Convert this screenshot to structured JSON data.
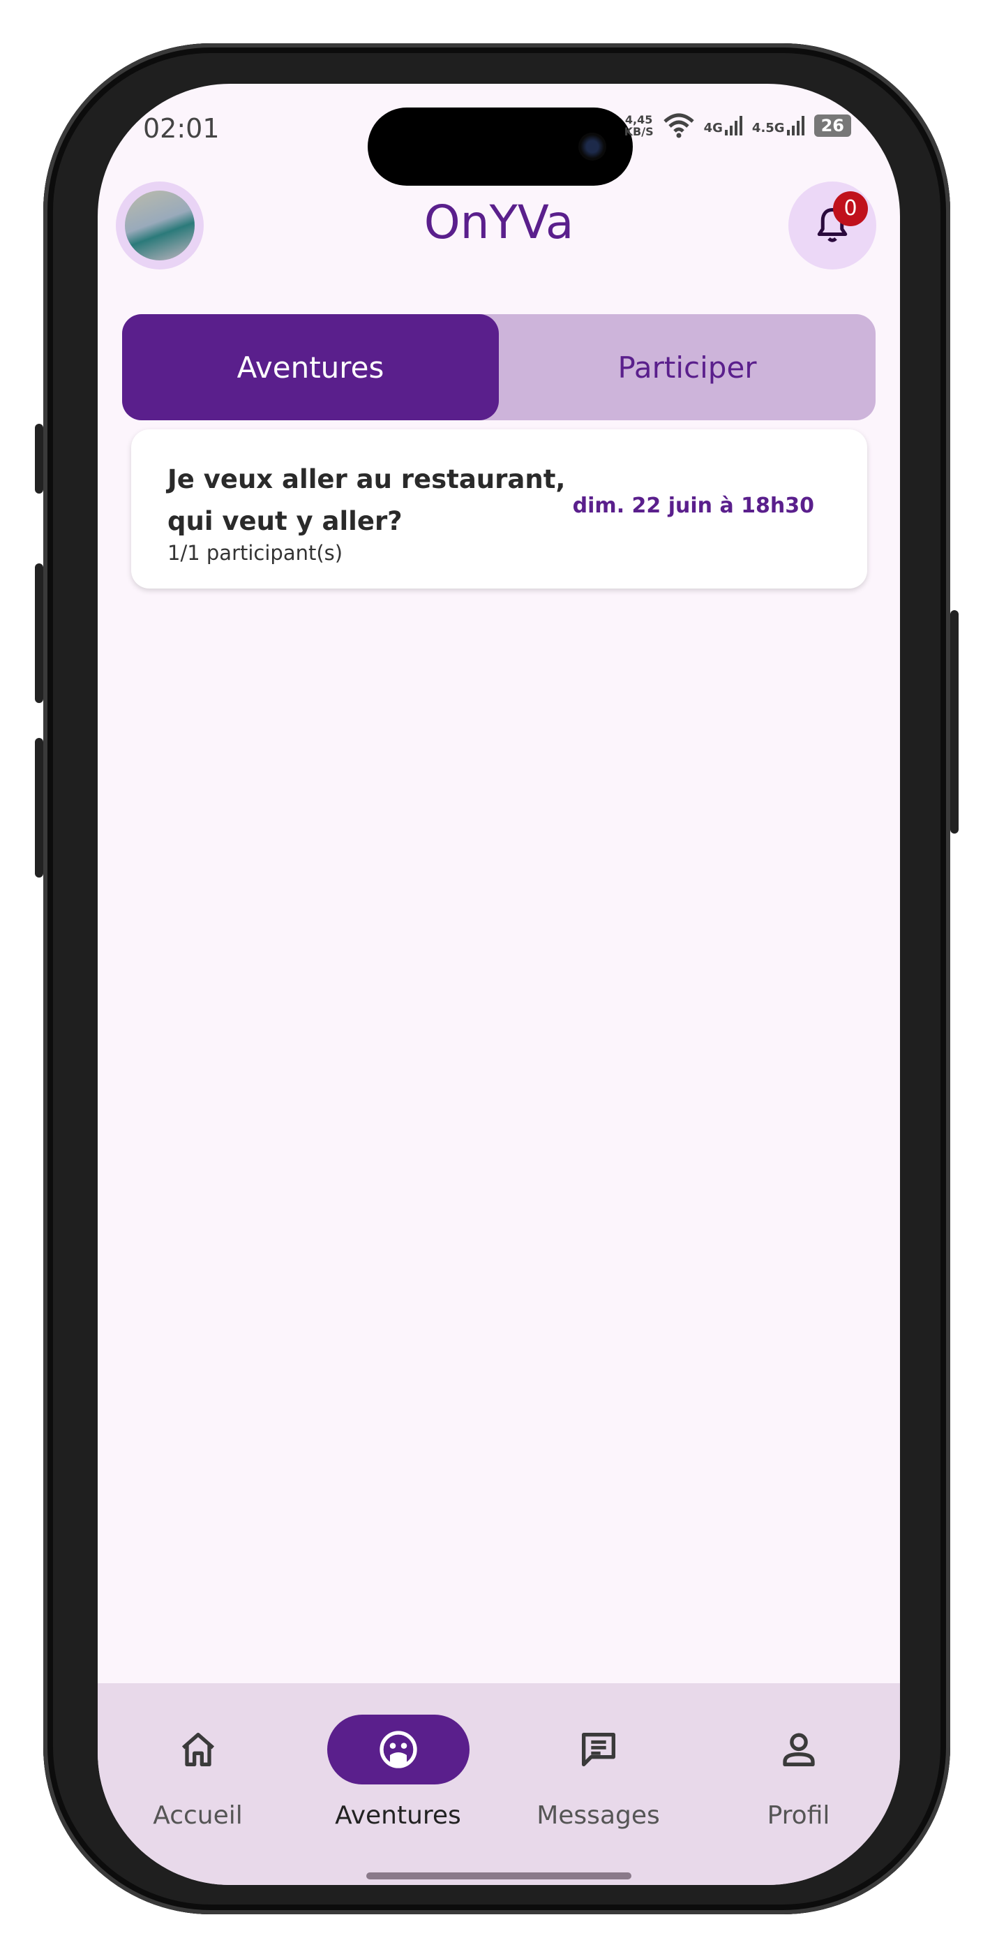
{
  "status_bar": {
    "time": "02:01",
    "speed_value": "4,45",
    "speed_unit": "KB/S",
    "net1": "4G",
    "net2": "4.5G",
    "battery": "26"
  },
  "header": {
    "brand": "OnYVa",
    "notification_count": "0"
  },
  "tabs": [
    {
      "label": "Aventures",
      "active": true
    },
    {
      "label": "Participer",
      "active": false
    }
  ],
  "adventures": [
    {
      "title": "Je veux aller au restaurant, qui veut y aller?",
      "participants": "1/1 participant(s)",
      "date": "dim. 22 juin à 18h30"
    }
  ],
  "bottom_nav": [
    {
      "label": "Accueil",
      "icon": "home-icon",
      "active": false
    },
    {
      "label": "Aventures",
      "icon": "explore-icon",
      "active": true
    },
    {
      "label": "Messages",
      "icon": "message-icon",
      "active": false
    },
    {
      "label": "Profil",
      "icon": "person-icon",
      "active": false
    }
  ],
  "colors": {
    "brand_purple": "#5a1f8c",
    "tab_bg": "#cdb4da",
    "screen_bg": "#fcf5fc",
    "nav_bg": "#e8d9ea",
    "badge_red": "#c0111c"
  }
}
